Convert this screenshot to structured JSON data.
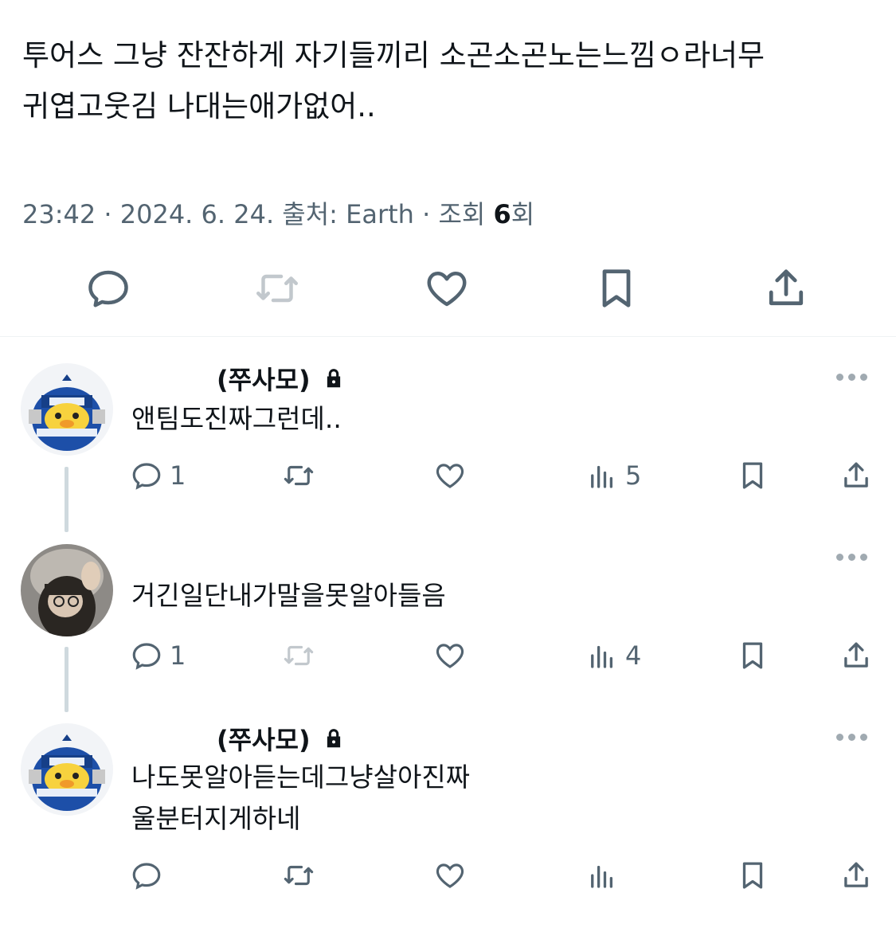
{
  "tweet": {
    "text_line1": "투어스 그냥 잔잔하게 자기들끼리 소곤소곤노는느낌ㅇ라너무",
    "text_line2": "귀엽고웃김 나대는애가없어..",
    "time": "23:42",
    "date": "2024. 6. 24.",
    "source_label": "출처: Earth",
    "views_label": "조회",
    "views_count": "6",
    "views_suffix": "회",
    "separator": "·"
  },
  "actions": [
    {
      "name": "reply-icon"
    },
    {
      "name": "retweet-icon"
    },
    {
      "name": "like-icon"
    },
    {
      "name": "bookmark-icon"
    },
    {
      "name": "share-icon"
    }
  ],
  "replies": [
    {
      "name": "(쭈사모)",
      "locked": true,
      "text_lines": [
        "앤팀도진짜그런데.."
      ],
      "reply_count": "1",
      "retweet_count": "",
      "like_count": "",
      "views_count": "5"
    },
    {
      "name": "",
      "locked": false,
      "text_lines": [
        "거긴일단내가말을못알아들음"
      ],
      "reply_count": "1",
      "retweet_count": "",
      "like_count": "",
      "views_count": "4",
      "retweet_disabled": true
    },
    {
      "name": "(쭈사모)",
      "locked": true,
      "text_lines": [
        "나도못알아듣는데그냥살아진짜",
        "울분터지게하네"
      ],
      "reply_count": "",
      "retweet_count": "",
      "like_count": "",
      "views_count": ""
    }
  ],
  "colors": {
    "text": "#0f1419",
    "secondary": "#536471",
    "divider": "#eff3f4",
    "thread_line": "#cfd9de",
    "avatar_blue": "#1d4fa8"
  }
}
